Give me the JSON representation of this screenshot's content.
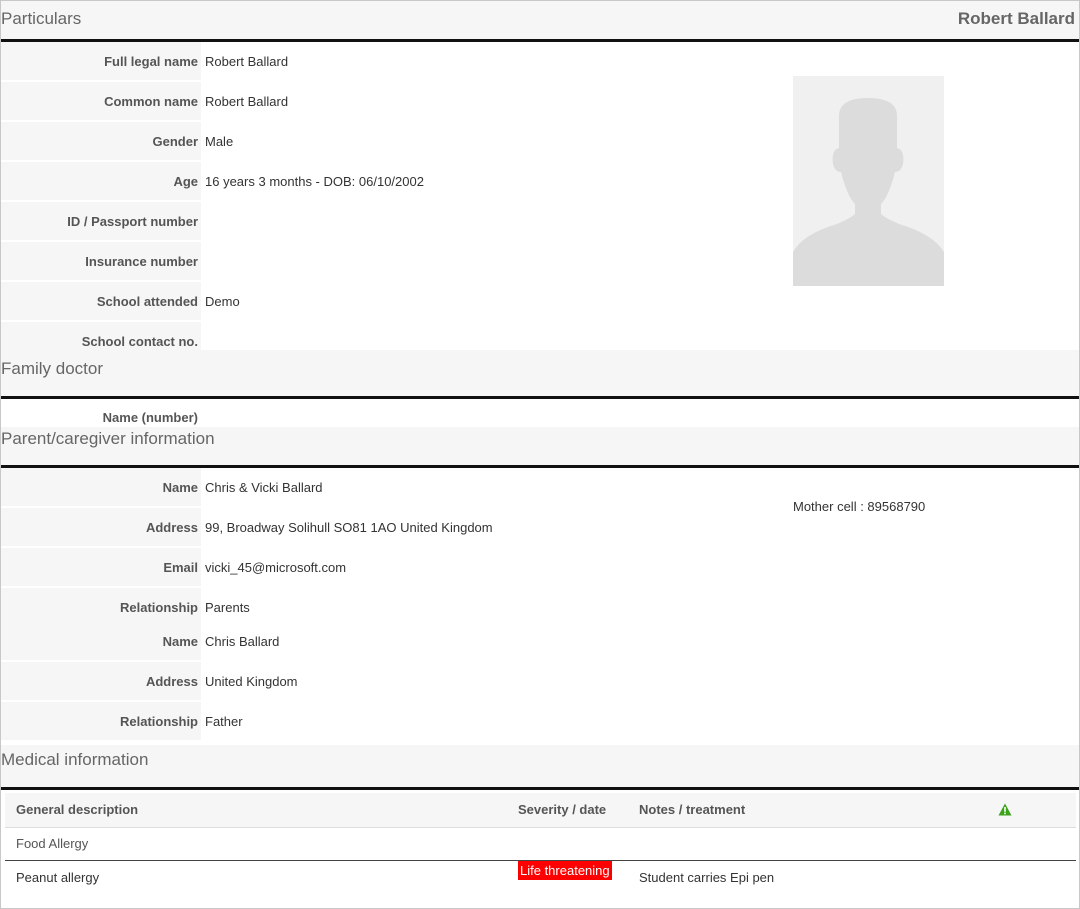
{
  "particulars": {
    "title": "Particulars",
    "student_name": "Robert Ballard",
    "rows": [
      {
        "label": "Full legal name",
        "value": "Robert Ballard"
      },
      {
        "label": "Common name",
        "value": "Robert Ballard"
      },
      {
        "label": "Gender",
        "value": "Male"
      },
      {
        "label": "Age",
        "value": "16 years 3 months - DOB: 06/10/2002"
      },
      {
        "label": "ID / Passport number",
        "value": ""
      },
      {
        "label": "Insurance number",
        "value": ""
      },
      {
        "label": "School attended",
        "value": "Demo"
      },
      {
        "label": "School contact no.",
        "value": ""
      }
    ],
    "photo_icon": "avatar-placeholder-icon"
  },
  "family_doctor": {
    "title": "Family doctor",
    "rows": [
      {
        "label": "Name (number)",
        "value": ""
      }
    ]
  },
  "parent_info": {
    "title": "Parent/caregiver information",
    "rows": [
      {
        "label": "Name",
        "value": "Chris & Vicki Ballard"
      },
      {
        "label": "Address",
        "value": "99, Broadway Solihull SO81 1AO United Kingdom"
      },
      {
        "label": "Email",
        "value": "vicki_45@microsoft.com"
      },
      {
        "label": "Relationship",
        "value": "Parents"
      },
      {
        "label": "Name",
        "value": "Chris Ballard"
      },
      {
        "label": "Address",
        "value": "United Kingdom"
      },
      {
        "label": "Relationship",
        "value": "Father"
      }
    ],
    "mother_cell": "Mother cell : 89568790"
  },
  "medical": {
    "title": "Medical information",
    "columns": {
      "description": "General description",
      "severity": "Severity / date",
      "notes": "Notes / treatment"
    },
    "warning_icon": "warning-triangle-icon",
    "group": "Food Allergy",
    "entries": [
      {
        "description": "Peanut allergy",
        "severity": "Life threatening",
        "notes": "Student carries Epi pen"
      }
    ]
  },
  "colors": {
    "severity_badge": "#ff0000",
    "warning_icon": "#3aa31a",
    "section_divider": "#111111"
  }
}
